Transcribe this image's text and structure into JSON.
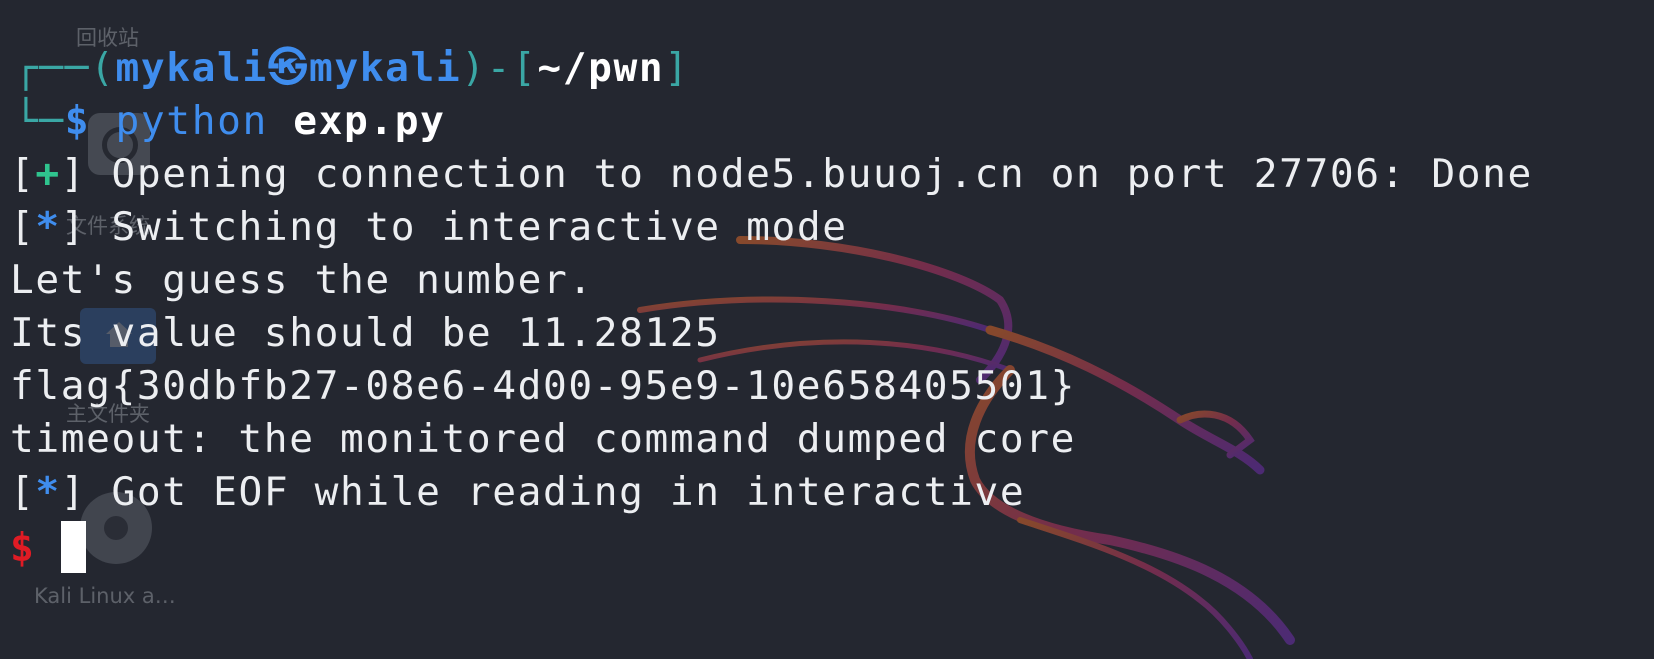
{
  "desktop": {
    "icons": [
      {
        "name": "trash-icon",
        "label": "回收站"
      },
      {
        "name": "filesystem-icon",
        "label": "文件系统"
      },
      {
        "name": "home-folder-icon",
        "label": "主文件夹"
      },
      {
        "name": "kali-linux-icon",
        "label": "Kali Linux a…"
      }
    ]
  },
  "terminal": {
    "prompt": {
      "corner_top": "┌──(",
      "user": "mykali",
      "at_symbol": "㉿",
      "host": "mykali",
      "dir_open": ")-[",
      "cwd": "~/pwn",
      "dir_close": "]",
      "corner_bottom": "└─",
      "dollar": "$",
      "command": "python",
      "argument": "exp.py"
    },
    "output": [
      {
        "marker": "+",
        "text": "Opening connection to node5.buuoj.cn on port 27706: Done"
      },
      {
        "marker": "*",
        "text": "Switching to interactive mode"
      },
      {
        "marker": "",
        "text": "Let's guess the number."
      },
      {
        "marker": "",
        "text": "Its value should be 11.28125"
      },
      {
        "marker": "",
        "text": "flag{30dbfb27-08e6-4d00-95e9-10e658405501}"
      },
      {
        "marker": "",
        "text": "timeout: the monitored command dumped core"
      },
      {
        "marker": "*",
        "text": "Got EOF while reading in interactive"
      }
    ],
    "final_prompt": "$"
  },
  "colors": {
    "background": "#242730",
    "prompt_user": "#3f8dee",
    "prompt_frame": "#3aa7a5",
    "success_marker": "#2fc48e",
    "info_marker": "#3f8dee",
    "remote_prompt": "#e01b24",
    "text": "#eceef1"
  }
}
